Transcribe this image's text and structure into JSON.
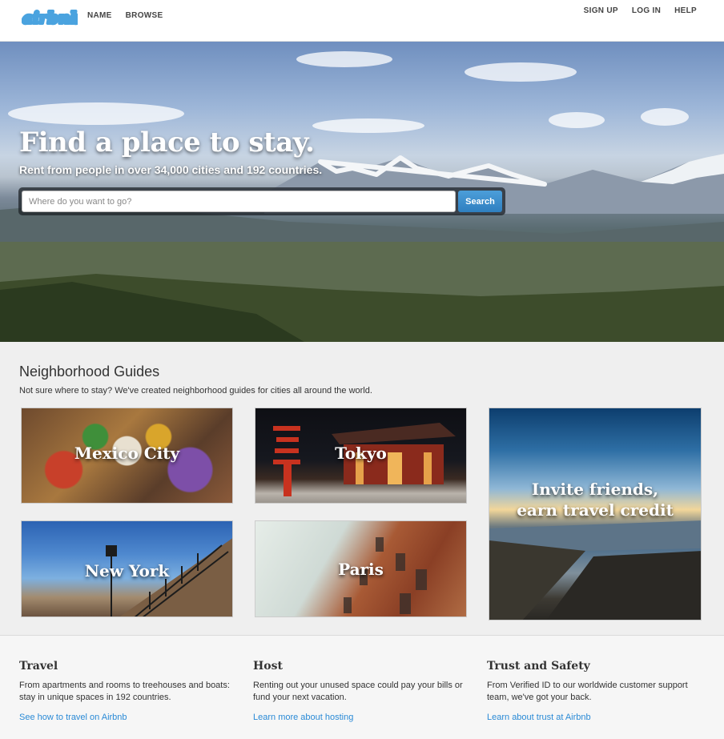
{
  "header": {
    "logo_text": "airbnb",
    "nav_left": [
      "NAME",
      "BROWSE"
    ],
    "nav_right": [
      "SIGN UP",
      "LOG IN",
      "HELP"
    ]
  },
  "hero": {
    "title": "Find a place to stay.",
    "subtitle": "Rent from people in over 34,000 cities and 192 countries.",
    "search_placeholder": "Where do you want to go?",
    "search_button": "Search"
  },
  "guides": {
    "title": "Neighborhood Guides",
    "description": "Not sure where to stay? We've created neighborhood guides for cities all around the world.",
    "tiles": [
      {
        "label": "Mexico City"
      },
      {
        "label": "Tokyo"
      },
      {
        "label": "New York"
      },
      {
        "label": "Paris"
      }
    ],
    "invite": {
      "line1": "Invite friends,",
      "line2": "earn travel credit"
    }
  },
  "footer": {
    "columns": [
      {
        "title": "Travel",
        "text": "From apartments and rooms to treehouses and boats: stay in unique spaces in 192 countries.",
        "link": "See how to travel on Airbnb"
      },
      {
        "title": "Host",
        "text": "Renting out your unused space could pay your bills or fund your next vacation.",
        "link": "Learn more about hosting"
      },
      {
        "title": "Trust and Safety",
        "text": "From Verified ID to our worldwide customer support team, we've got your back.",
        "link": "Learn about trust at Airbnb"
      }
    ]
  },
  "colors": {
    "brand": "#4aa3df",
    "link": "#2a8ad6",
    "search_button": "#3a8dcc"
  }
}
